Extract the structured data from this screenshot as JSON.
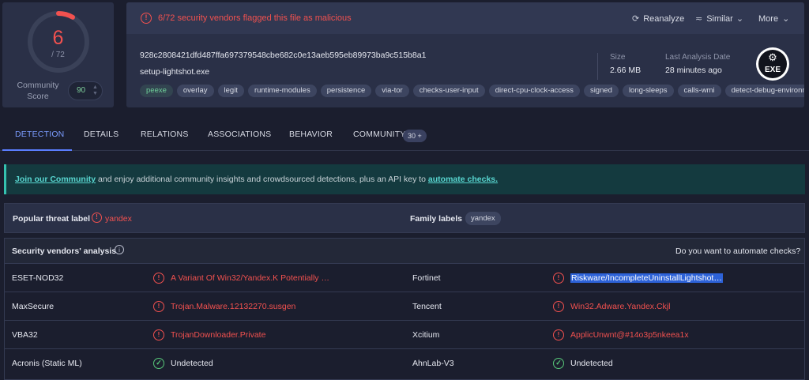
{
  "score": {
    "detections": "6",
    "total": "/ 72",
    "community_label": "Community Score",
    "community_value": "90",
    "ratio": 0.0833
  },
  "alert": {
    "text": "6/72 security vendors flagged this file as malicious",
    "icon": "alert-circle-icon",
    "reanalyze": "Reanalyze",
    "similar": "Similar",
    "more": "More"
  },
  "file": {
    "hash": "928c2808421dfd487ffa697379548cbe682c0e13aeb595eb89973ba9c515b8a1",
    "name": "setup-lightshot.exe",
    "size_label": "Size",
    "size_value": "2.66 MB",
    "last_label": "Last Analysis Date",
    "last_value": "28 minutes ago",
    "type_badge": "EXE",
    "tags": [
      "peexe",
      "overlay",
      "legit",
      "runtime-modules",
      "persistence",
      "via-tor",
      "checks-user-input",
      "direct-cpu-clock-access",
      "signed",
      "long-sleeps",
      "calls-wmi",
      "detect-debug-environment"
    ]
  },
  "tabs": {
    "detection": "DETECTION",
    "details": "DETAILS",
    "relations": "RELATIONS",
    "associations": "ASSOCIATIONS",
    "behavior": "BEHAVIOR",
    "community": "COMMUNITY",
    "community_badge": "30 +"
  },
  "banner": {
    "link1": "Join our Community",
    "middle": " and enjoy additional community insights and crowdsourced detections, plus an API key to ",
    "link2": "automate checks."
  },
  "threat": {
    "label": "Popular threat label",
    "value": "yandex",
    "family_label": "Family labels",
    "family_tag": "yandex"
  },
  "vendors": {
    "title": "Security vendors' analysis",
    "automate_question": "Do you want to automate checks?",
    "rows": [
      {
        "left_name": "ESET-NOD32",
        "left_result": "A Variant Of Win32/Yandex.K Potentially …",
        "left_status": "malicious",
        "right_name": "Fortinet",
        "right_result": "Riskware/IncompleteUninstallLightshot…",
        "right_status": "malicious"
      },
      {
        "left_name": "MaxSecure",
        "left_result": "Trojan.Malware.12132270.susgen",
        "left_status": "malicious",
        "right_name": "Tencent",
        "right_result": "Win32.Adware.Yandex.Ckjl",
        "right_status": "malicious"
      },
      {
        "left_name": "VBA32",
        "left_result": "TrojanDownloader.Private",
        "left_status": "malicious",
        "right_name": "Xcitium",
        "right_result": "ApplicUnwnt@#14o3p5nkeea1x",
        "right_status": "malicious"
      },
      {
        "left_name": "Acronis (Static ML)",
        "left_result": "Undetected",
        "left_status": "undetected",
        "right_name": "AhnLab-V3",
        "right_result": "Undetected",
        "right_status": "undetected"
      }
    ]
  },
  "colors": {
    "malicious": "#f2514f",
    "undetected": "#58c97a",
    "accent": "#5a7dff",
    "banner_bg": "#143a3f"
  }
}
